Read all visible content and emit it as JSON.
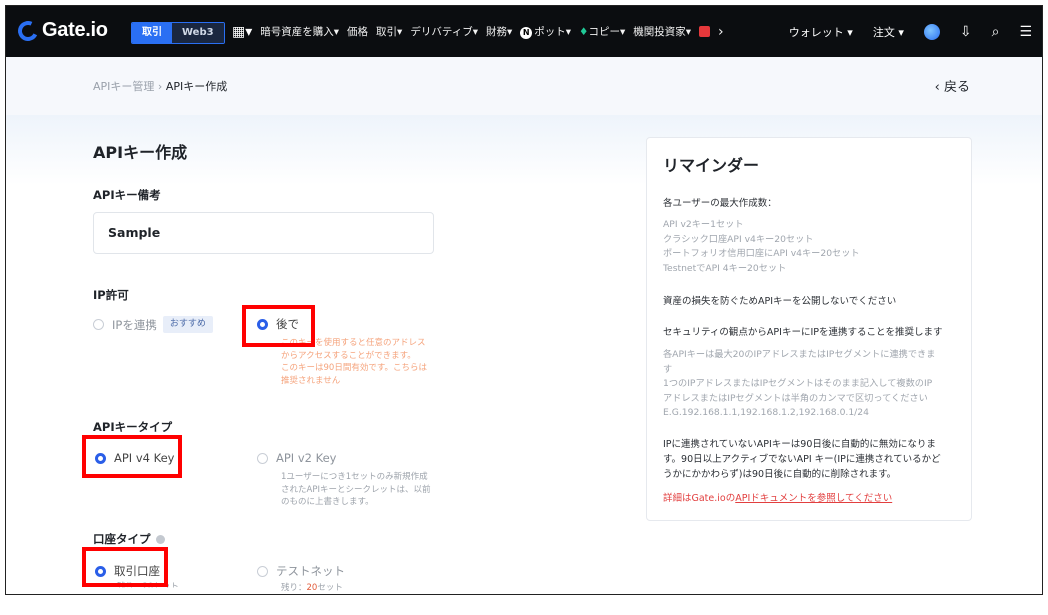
{
  "nav": {
    "brand": "Gate.io",
    "segment": [
      "取引",
      "Web3"
    ],
    "menu": [
      "暗号資産を購入▾",
      "価格",
      "取引▾",
      "デリバティブ▾",
      "財務▾",
      "ポット▾",
      "コピー▾",
      "機関投資家▾"
    ],
    "menu_more": "›",
    "right": [
      "ウォレット ▾",
      "注文 ▾"
    ]
  },
  "breadcrumb": {
    "parent": "APIキー管理",
    "sep": "›",
    "current": "APIキー作成",
    "back": "‹ 戻る"
  },
  "form": {
    "title": "APIキー作成",
    "memo_label": "APIキー備考",
    "memo_value": "Sample",
    "ip_label": "IP許可",
    "ip_options": [
      {
        "label": "IPを連携",
        "tag": "おすすめ",
        "selected": false
      },
      {
        "label": "後で",
        "selected": true
      }
    ],
    "ip_note": [
      "このキーを使用すると任意のアドレス",
      "からアクセスすることができます。",
      "このキーは90日間有効です。こちらは",
      "推奨されません"
    ],
    "type_label": "APIキータイプ",
    "type_options": [
      {
        "label": "API v4 Key",
        "selected": true
      },
      {
        "label": "API v2 Key",
        "selected": false
      }
    ],
    "type_note": [
      "1ユーザーにつき1セットのみ新規作成",
      "されたAPIキーとシークレットは、以前",
      "のものに上書きします。"
    ],
    "account_label": "口座タイプ",
    "account_options": [
      {
        "label": "取引口座",
        "selected": true
      },
      {
        "label": "テストネット",
        "selected": false
      }
    ],
    "account_note_prefix": "残り：",
    "account_note_value": "20",
    "account_note_suffix": "セット",
    "account_note_left": "残り：20セット"
  },
  "reminder": {
    "title": "リマインダー",
    "max_heading": "各ユーザーの最大作成数：",
    "max_lines": [
      "API v2キー1セット",
      "クラシック口座API v4キー20セット",
      "ポートフォリオ信用口座にAPI v4キー20セット",
      "TestnetでAPI 4キー20セット"
    ],
    "warn1": "資産の損失を防ぐためAPIキーを公開しないでください",
    "warn2": "セキュリティの観点からAPIキーにIPを連携することを推奨します",
    "ip_lines": [
      "各APIキーは最大20のIPアドレスまたはIPセグメントに連携できま",
      "す",
      "1つのIPアドレスまたはIPセグメントはそのまま記入して複数のIP",
      "アドレスまたはIPセグメントは半角のカンマで区切ってください",
      "E.G.192.168.1.1,192.168.1.2,192.168.0.1/24"
    ],
    "expire_lines": [
      "IPに連携されていないAPIキーは90日後に自動的に無効になりま",
      "す。90日以上アクティブでないAPI キー(IPに連携されているかど",
      "うかにかかわらず)は90日後に自動的に削除されます。"
    ],
    "doc_prefix": "詳細はGate.ioの",
    "doc_link": "APIドキュメントを参照してください"
  },
  "colors": {
    "accent": "#2a5ee8",
    "highlight": "#ff0000",
    "warn": "#f5a37c",
    "link": "#e23f3f"
  }
}
